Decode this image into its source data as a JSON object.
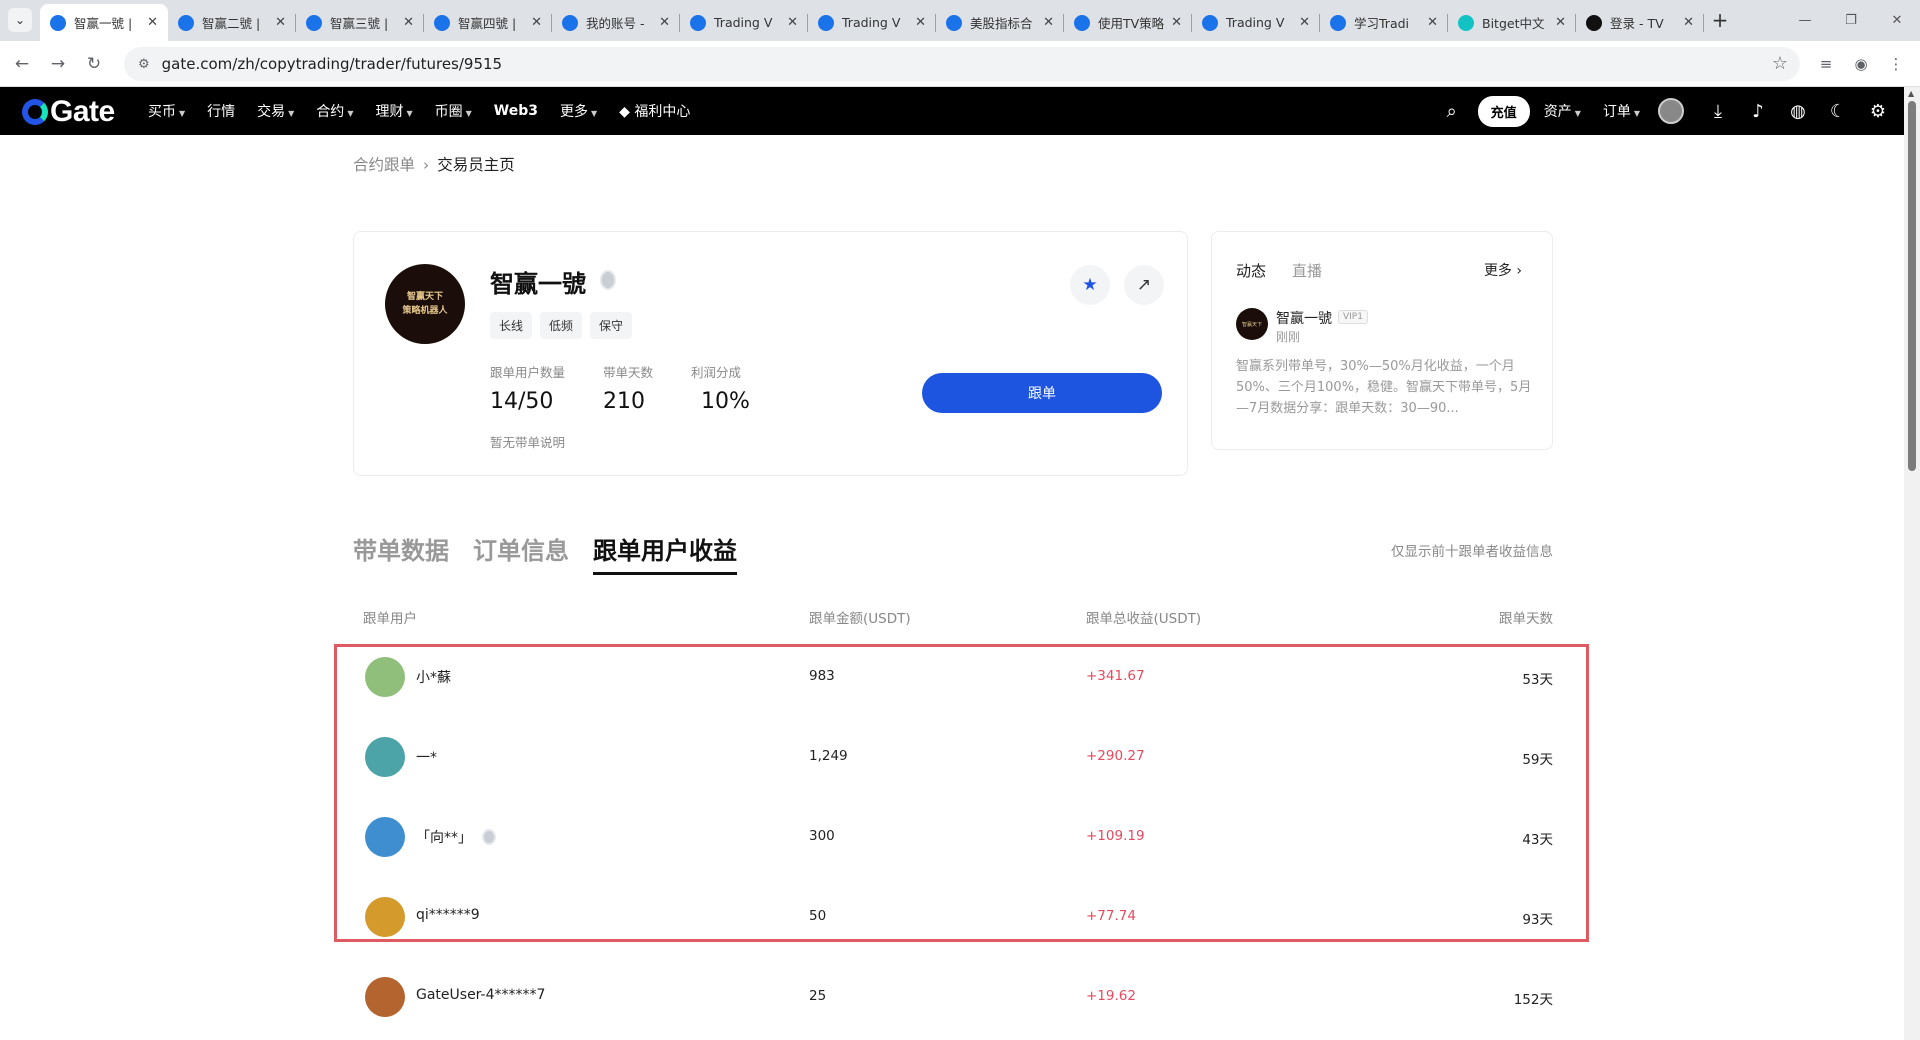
{
  "browser": {
    "tabs": [
      {
        "title": "智赢一號 |",
        "color": "#1a73e8",
        "active": true
      },
      {
        "title": "智赢二號 |",
        "color": "#1a73e8"
      },
      {
        "title": "智赢三號 |",
        "color": "#1a73e8"
      },
      {
        "title": "智赢四號 |",
        "color": "#1a73e8"
      },
      {
        "title": "我的账号 -",
        "color": "#1a73e8"
      },
      {
        "title": "Trading V",
        "color": "#1a73e8"
      },
      {
        "title": "Trading V",
        "color": "#1a73e8"
      },
      {
        "title": "美股指标合",
        "color": "#1a73e8"
      },
      {
        "title": "使用TV策略",
        "color": "#1a73e8"
      },
      {
        "title": "Trading V",
        "color": "#1a73e8"
      },
      {
        "title": "学习Tradi",
        "color": "#1a73e8"
      },
      {
        "title": "Bitget中文",
        "color": "#13c2c2"
      },
      {
        "title": "登录 - TV",
        "color": "#111111"
      }
    ],
    "url": "gate.com/zh/copytrading/trader/futures/9515"
  },
  "nav": {
    "logo": "Gate",
    "items": [
      {
        "label": "买币",
        "caret": true
      },
      {
        "label": "行情",
        "caret": false
      },
      {
        "label": "交易",
        "caret": true
      },
      {
        "label": "合约",
        "caret": true
      },
      {
        "label": "理财",
        "caret": true
      },
      {
        "label": "币圈",
        "caret": true
      },
      {
        "label": "Web3",
        "caret": false,
        "bold": true
      },
      {
        "label": "更多",
        "caret": true
      },
      {
        "label": "福利中心",
        "caret": false
      }
    ],
    "recharge": "充值",
    "assets": "资产",
    "orders": "订单"
  },
  "breadcrumb": {
    "parent": "合约跟单",
    "current": "交易员主页"
  },
  "trader": {
    "avatar_line1": "智赢天下",
    "avatar_line2": "策略机器人",
    "name": "智赢一號",
    "tags": [
      "长线",
      "低频",
      "保守"
    ],
    "stats": [
      {
        "label": "跟单用户数量",
        "value": "14/50"
      },
      {
        "label": "带单天数",
        "value": "210"
      },
      {
        "label": "利润分成",
        "value": "10%"
      }
    ],
    "no_desc": "暂无带单说明",
    "follow_label": "跟单"
  },
  "feed": {
    "tab_active": "动态",
    "tab_other": "直播",
    "more": "更多",
    "author": "智赢一號",
    "vip": "VIP1",
    "time": "刚刚",
    "content": "智赢系列带单号，30%—50%月化收益，一个月50%、三个月100%，稳健。智赢天下带单号，5月—7月数据分享：跟单天数：30—90..."
  },
  "sections": {
    "tabs": [
      "带单数据",
      "订单信息",
      "跟单用户收益"
    ],
    "active_index": 2,
    "note": "仅显示前十跟单者收益信息"
  },
  "table": {
    "headers": [
      "跟单用户",
      "跟单金额(USDT)",
      "跟单总收益(USDT)",
      "跟单天数"
    ],
    "rows": [
      {
        "user": "小*蘇",
        "amount": "983",
        "pnl": "+341.67",
        "days": "53天",
        "avatar": "#8fbf7a",
        "medal": false
      },
      {
        "user": "一*",
        "amount": "1,249",
        "pnl": "+290.27",
        "days": "59天",
        "avatar": "#4ca3a8",
        "medal": false
      },
      {
        "user": "「向**」",
        "amount": "300",
        "pnl": "+109.19",
        "days": "43天",
        "avatar": "#3f8fd0",
        "medal": true
      },
      {
        "user": "qi******9",
        "amount": "50",
        "pnl": "+77.74",
        "days": "93天",
        "avatar": "#d49a2c",
        "medal": false
      },
      {
        "user": "GateUser-4******7",
        "amount": "25",
        "pnl": "+19.62",
        "days": "152天",
        "avatar": "#b4652f",
        "medal": false
      }
    ]
  },
  "colors": {
    "accent": "#1e55e0",
    "positive": "#e8495f",
    "highlight_box": "#e05a62"
  }
}
